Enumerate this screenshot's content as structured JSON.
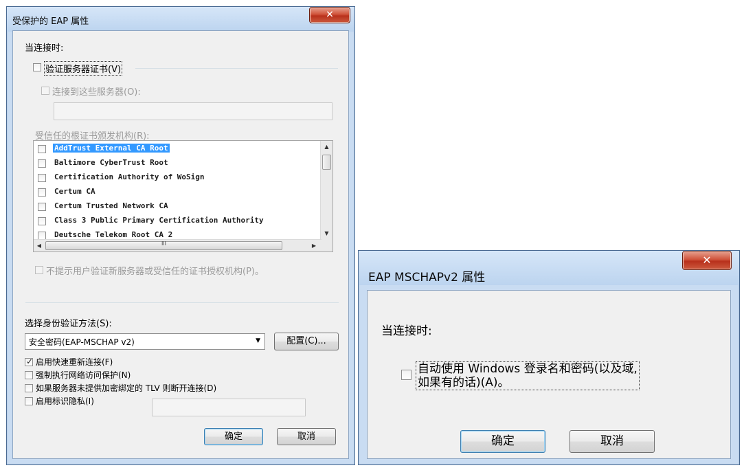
{
  "peap_dialog": {
    "title": "受保护的 EAP 属性",
    "close_glyph": "✕",
    "when_connecting": "当连接时:",
    "verify_server_cert": "验证服务器证书(V)",
    "connect_to_servers": "连接到这些服务器(O):",
    "servers_value": "",
    "trusted_root_ca": "受信任的根证书颁发机构(R):",
    "cert_list": [
      {
        "name": "AddTrust External CA Root",
        "selected": true
      },
      {
        "name": "Baltimore CyberTrust Root",
        "selected": false
      },
      {
        "name": "Certification Authority of WoSign",
        "selected": false
      },
      {
        "name": "Certum CA",
        "selected": false
      },
      {
        "name": "Certum Trusted Network CA",
        "selected": false
      },
      {
        "name": "Class 3 Public Primary Certification Authority",
        "selected": false
      },
      {
        "name": "Deutsche Telekom Root CA 2",
        "selected": false
      }
    ],
    "scroll_up": "▲",
    "scroll_down": "▼",
    "scroll_left": "◀",
    "scroll_right": "▶",
    "hscroll_grip": "III",
    "no_prompt": "不提示用户验证新服务器或受信任的证书授权机构(P)。",
    "select_auth_method": "选择身份验证方法(S):",
    "auth_method_value": "安全密码(EAP-MSCHAP v2)",
    "dropdown_arrow": "▼",
    "configure_button": "配置(C)...",
    "enable_fast_reconnect": "启用快速重新连接(F)",
    "enable_fast_reconnect_checked": true,
    "enforce_nap": "强制执行网络访问保护(N)",
    "disconnect_no_tlv": "如果服务器未提供加密绑定的 TLV 则断开连接(D)",
    "enable_identity_privacy": "启用标识隐私(I)",
    "identity_privacy_value": "",
    "ok_button": "确定",
    "cancel_button": "取消",
    "check_glyph": "✓"
  },
  "mschap_dialog": {
    "title": "EAP MSCHAPv2 属性",
    "close_glyph": "✕",
    "when_connecting": "当连接时:",
    "auto_use_windows_line1": "自动使用 Windows 登录名和密码(以及域,",
    "auto_use_windows_line2": "如果有的话)(A)。",
    "ok_button": "确定",
    "cancel_button": "取消"
  }
}
